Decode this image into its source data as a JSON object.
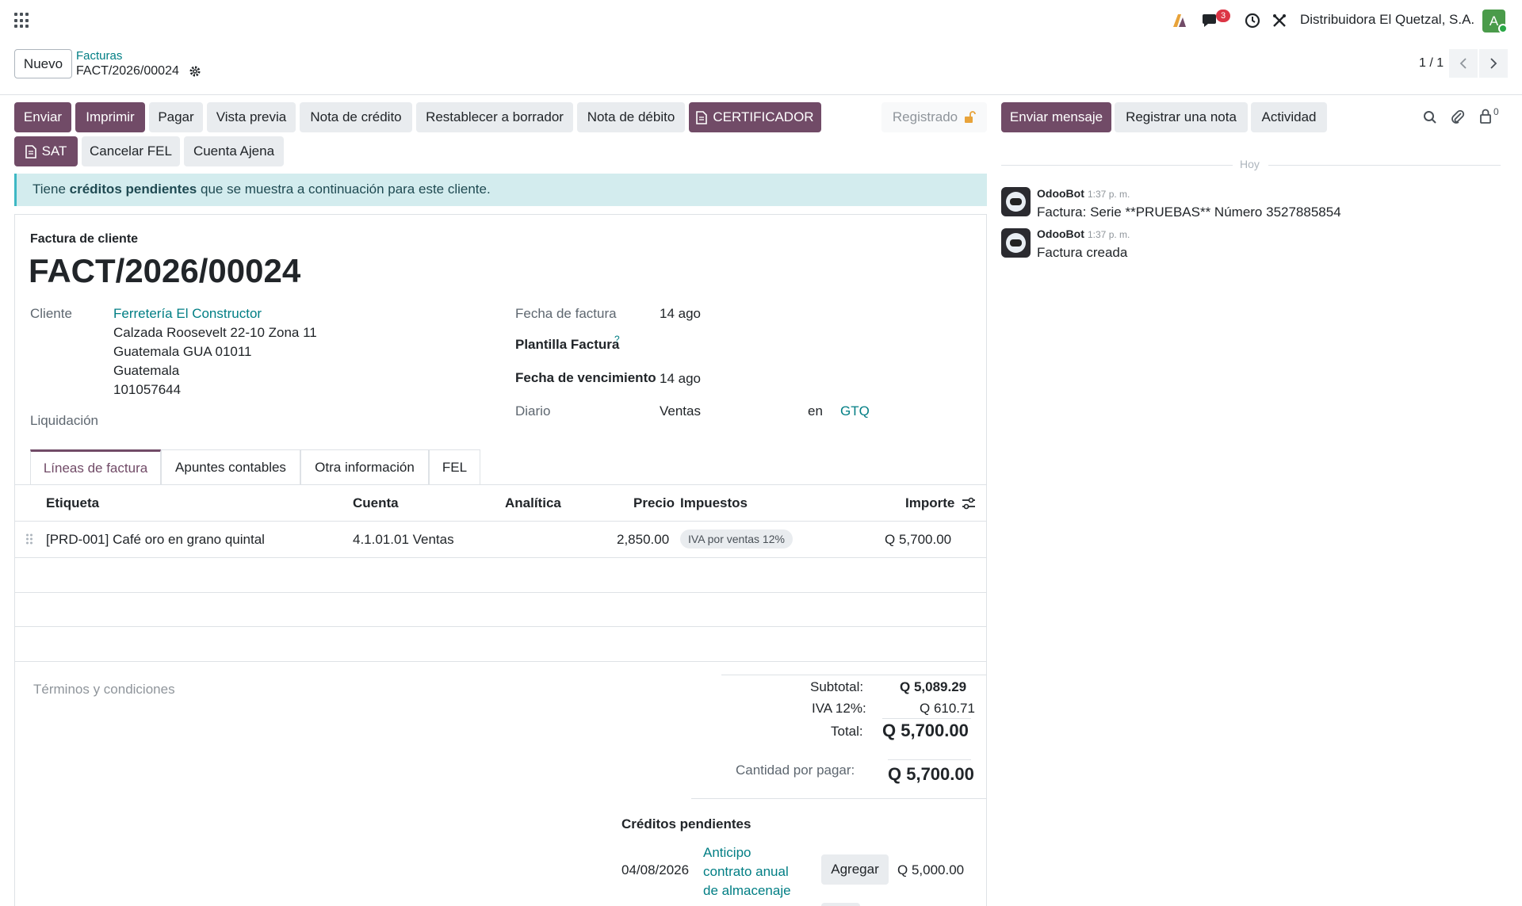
{
  "navbar": {
    "company": "Distribuidora El Quetzal, S.A.",
    "messages_badge": "3",
    "avatar_letter": "A"
  },
  "control_panel": {
    "new_label": "Nuevo",
    "breadcrumb_parent": "Facturas",
    "breadcrumb_current": "FACT/2026/00024",
    "pager": "1 / 1"
  },
  "buttons": {
    "enviar": "Enviar",
    "imprimir": "Imprimir",
    "pagar": "Pagar",
    "vista_previa": "Vista previa",
    "nota_credito": "Nota de crédito",
    "restablecer": "Restablecer a borrador",
    "nota_debito": "Nota de débito",
    "certificador": "CERTIFICADOR",
    "sat": "SAT",
    "cancelar_fel": "Cancelar FEL",
    "cuenta_ajena": "Cuenta Ajena",
    "status": "Registrado"
  },
  "chatter_buttons": {
    "send_message": "Enviar mensaje",
    "log_note": "Registrar una nota",
    "activity": "Actividad",
    "followers_count": "0"
  },
  "alert": {
    "prefix": "Tiene",
    "bold": "créditos pendientes",
    "suffix": "que se muestra a continuación para este cliente."
  },
  "invoice": {
    "type": "Factura de cliente",
    "number": "FACT/2026/00024",
    "customer_label": "Cliente",
    "customer_name": "Ferretería El Constructor",
    "address": [
      "Calzada Roosevelt 22-10 Zona 11",
      "Guatemala GUA 01011",
      "Guatemala",
      "101057644"
    ],
    "liquidacion_label": "Liquidación",
    "invoice_date_label": "Fecha de factura",
    "invoice_date": "14 ago",
    "template_label": "Plantilla Factura",
    "template_help": "?",
    "due_date_label": "Fecha de vencimiento",
    "due_date": "14 ago",
    "journal_label": "Diario",
    "journal": "Ventas",
    "in_label": "en",
    "currency": "GTQ"
  },
  "tabs": [
    {
      "label": "Líneas de factura",
      "active": true
    },
    {
      "label": "Apuntes contables"
    },
    {
      "label": "Otra información"
    },
    {
      "label": "FEL"
    }
  ],
  "table": {
    "headers": {
      "label": "Etiqueta",
      "account": "Cuenta",
      "analytic": "Analítica",
      "price": "Precio",
      "taxes": "Impuestos",
      "amount": "Importe"
    },
    "rows": [
      {
        "label": "[PRD-001] Café oro en grano quintal",
        "account": "4.1.01.01 Ventas",
        "price": "2,850.00",
        "tax": "IVA por ventas 12%",
        "amount": "Q 5,700.00"
      }
    ]
  },
  "terms_placeholder": "Términos y condiciones",
  "totals": {
    "subtotal_label": "Subtotal:",
    "subtotal": "Q 5,089.29",
    "iva_label": "IVA 12%:",
    "iva": "Q 610.71",
    "total_label": "Total:",
    "total": "Q 5,700.00",
    "due_label": "Cantidad por pagar:",
    "due": "Q 5,700.00"
  },
  "outstanding": {
    "title": "Créditos pendientes",
    "items": [
      {
        "date": "04/08/2026",
        "desc": [
          "Anticipo",
          "contrato anual",
          "de almacenaje"
        ],
        "button": "Agregar",
        "amount": "Q 5,000.00"
      }
    ]
  },
  "chatter": {
    "today_label": "Hoy",
    "messages": [
      {
        "author": "OdooBot",
        "time": "1:37 p. m.",
        "body": "Factura: Serie **PRUEBAS** Número 3527885854"
      },
      {
        "author": "OdooBot",
        "time": "1:37 p. m.",
        "body": "Factura creada"
      }
    ]
  },
  "colors": {
    "primary": "#714b67",
    "link": "#017e84",
    "alert_bg": "#d3ecee"
  }
}
